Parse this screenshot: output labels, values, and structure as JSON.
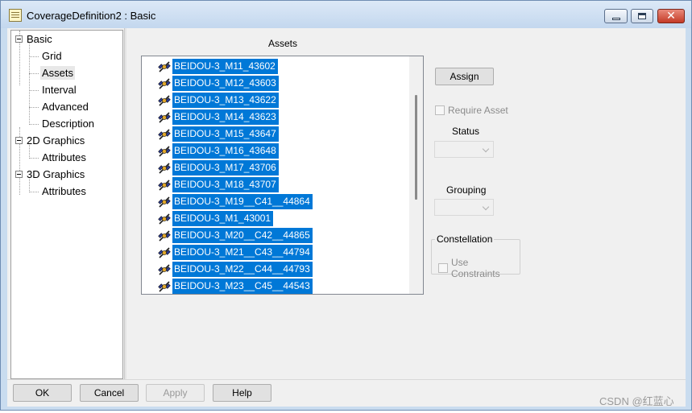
{
  "window": {
    "title": "CoverageDefinition2 : Basic"
  },
  "tree": {
    "items": [
      {
        "label": "Basic",
        "level": 0,
        "expanded": true
      },
      {
        "label": "Grid",
        "level": 1
      },
      {
        "label": "Assets",
        "level": 1,
        "selected": true
      },
      {
        "label": "Interval",
        "level": 1
      },
      {
        "label": "Advanced",
        "level": 1
      },
      {
        "label": "Description",
        "level": 1
      },
      {
        "label": "2D Graphics",
        "level": 0,
        "expanded": true
      },
      {
        "label": "Attributes",
        "level": 1
      },
      {
        "label": "3D Graphics",
        "level": 0,
        "expanded": true
      },
      {
        "label": "Attributes",
        "level": 1
      }
    ]
  },
  "assets": {
    "caption": "Assets",
    "items": [
      "BEIDOU-3_M11_43602",
      "BEIDOU-3_M12_43603",
      "BEIDOU-3_M13_43622",
      "BEIDOU-3_M14_43623",
      "BEIDOU-3_M15_43647",
      "BEIDOU-3_M16_43648",
      "BEIDOU-3_M17_43706",
      "BEIDOU-3_M18_43707",
      "BEIDOU-3_M19__C41__44864",
      "BEIDOU-3_M1_43001",
      "BEIDOU-3_M20__C42__44865",
      "BEIDOU-3_M21__C43__44794",
      "BEIDOU-3_M22__C44__44793",
      "BEIDOU-3_M23__C45__44543"
    ],
    "icon": "satellite-icon"
  },
  "controls": {
    "assign_label": "Assign",
    "require_asset_label": "Require Asset",
    "status_label": "Status",
    "status_value": "",
    "grouping_label": "Grouping",
    "grouping_value": "",
    "constellation_label": "Constellation",
    "use_constraints_label": "Use Constraints"
  },
  "footer": {
    "ok_label": "OK",
    "cancel_label": "Cancel",
    "apply_label": "Apply",
    "help_label": "Help"
  },
  "watermark": "CSDN @红蓝心",
  "colors": {
    "selection": "#0078d7",
    "face": "#f0f0f0",
    "frame": "#c9dcef"
  }
}
